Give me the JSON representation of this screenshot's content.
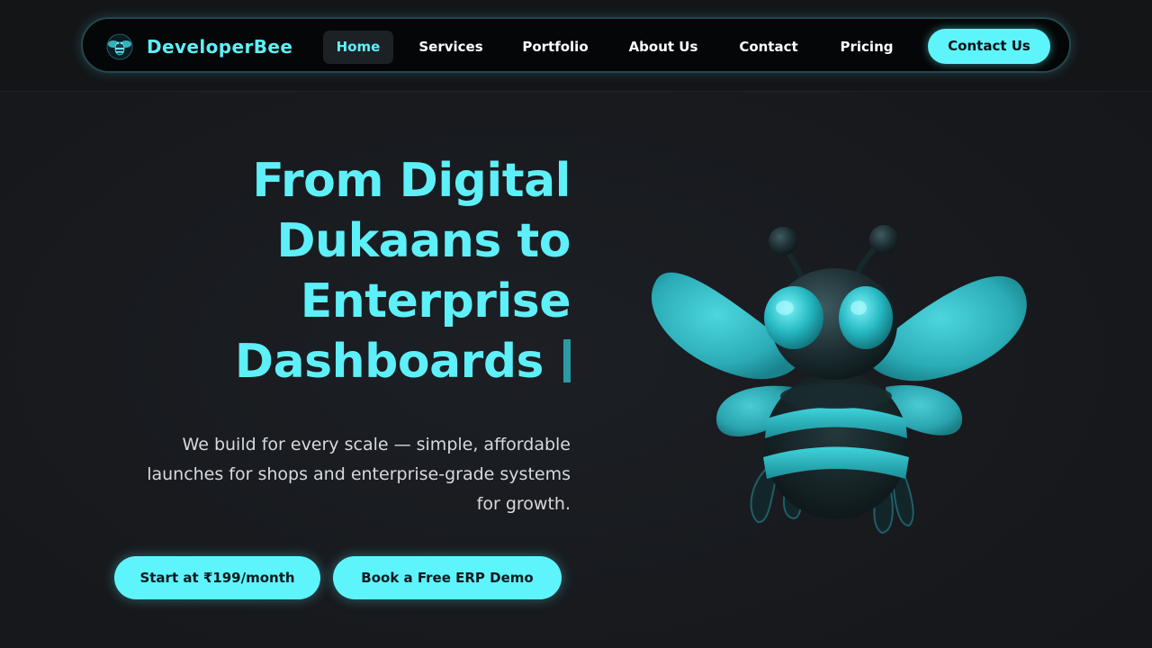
{
  "brand": {
    "name": "DeveloperBee",
    "accent_color": "#5ef0f8",
    "logo_icon": "bee-logo-icon"
  },
  "nav": {
    "items": [
      {
        "label": "Home",
        "active": true
      },
      {
        "label": "Services",
        "active": false
      },
      {
        "label": "Portfolio",
        "active": false
      },
      {
        "label": "About Us",
        "active": false
      },
      {
        "label": "Contact",
        "active": false
      },
      {
        "label": "Pricing",
        "active": false
      }
    ],
    "cta_label": "Contact Us"
  },
  "hero": {
    "title_lines": [
      "From Digital",
      "Dukaans to",
      "Enterprise",
      "Dashboards"
    ],
    "cursor": "|",
    "subtitle_lines": [
      "We build for every scale — simple, affordable",
      "launches for shops and enterprise-grade systems",
      "for growth."
    ],
    "primary_button": "Start at ₹199/month",
    "secondary_button": "Book a Free ERP Demo",
    "illustration_icon": "bee-mascot-illustration"
  },
  "colors": {
    "background": "#17191d",
    "accent": "#5ef4fc",
    "button_text": "#0b1a1e"
  }
}
